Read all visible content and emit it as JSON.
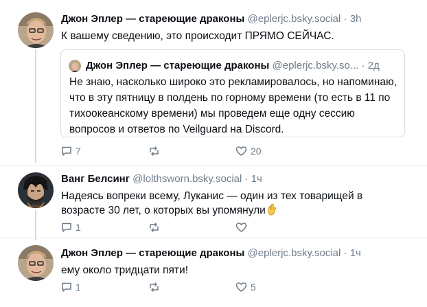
{
  "post1": {
    "author": "Джон Эплер — стареющие драконы",
    "handle": "@eplerjc.bsky.social",
    "dot": "·",
    "time": "3h",
    "text": "К вашему сведению, это происходит ПРЯМО СЕЙЧАС.",
    "quote": {
      "author": "Джон Эплер — стареющие драконы",
      "handle": "@eplerjc.bsky.so...",
      "dot": "·",
      "time": "2д",
      "text": "Не знаю, насколько широко это рекламировалось, но напоминаю, что в эту пятницу в полдень по горному времени (то есть в 11 по тихоокеанскому времени) мы проведем еще одну сессию вопросов и ответов по Veilguard на Discord."
    },
    "actions": {
      "replies": "7",
      "reposts": "",
      "likes": "20"
    }
  },
  "post2": {
    "author": "Ванг Белсинг",
    "handle": "@lolthsworn.bsky.social",
    "dot": "·",
    "time": "1ч",
    "text": "Надеясь вопреки всему, Луканис — один из тех товарищей в возрасте 30 лет, о которых вы упомянули",
    "actions": {
      "replies": "1",
      "reposts": "",
      "likes": ""
    }
  },
  "post3": {
    "author": "Джон Эплер — стареющие драконы",
    "handle": "@eplerjc.bsky.social",
    "dot": "·",
    "time": "1ч",
    "text": "ему около тридцати пяти!",
    "actions": {
      "replies": "1",
      "reposts": "",
      "likes": "5"
    }
  },
  "icons": {
    "reply": "speech-bubble-icon",
    "repost": "repost-arrows-icon",
    "like": "heart-icon",
    "emoji": "crossed-fingers-emoji"
  },
  "colors": {
    "muted": "#6f7b89",
    "thread_line": "#d4dbe2",
    "text": "#0b0f14"
  }
}
